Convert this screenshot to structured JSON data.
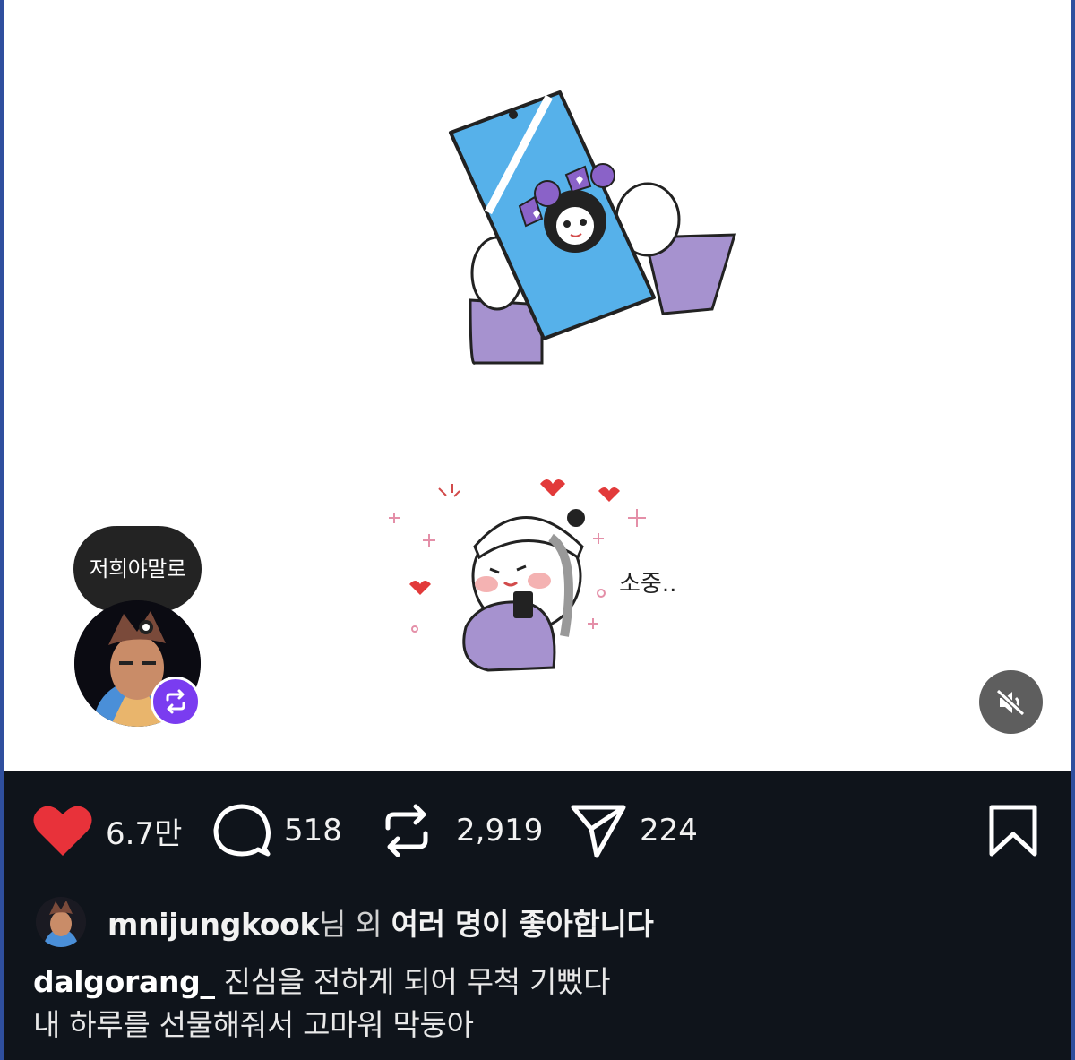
{
  "reaction": {
    "bubble_text": "저희야말로"
  },
  "stats": {
    "likes": "6.7만",
    "comments": "518",
    "reposts": "2,919",
    "shares": "224"
  },
  "likes_summary": {
    "username": "mnijungkook",
    "suffix": "님 외 ",
    "emphasis": "여러 명이 좋아합니다"
  },
  "caption": {
    "author": "dalgorang_",
    "line1": "진심을 전하게 되어 무척 기뻤다",
    "line2": "내 하루를 선물해줘서 고마워 막둥아"
  },
  "artwork_text": {
    "sticker_label": "소중.."
  },
  "icons": {
    "like": "heart-icon",
    "comment": "comment-bubble-icon",
    "repost": "repost-icon",
    "share": "paper-plane-icon",
    "bookmark": "bookmark-icon",
    "mute": "speaker-muted-icon",
    "badge": "repost-badge-icon"
  },
  "colors": {
    "like": "#e8323a",
    "badge": "#7a3cf0",
    "background": "#0f141b",
    "accent_frame": "#2f4f9e"
  }
}
